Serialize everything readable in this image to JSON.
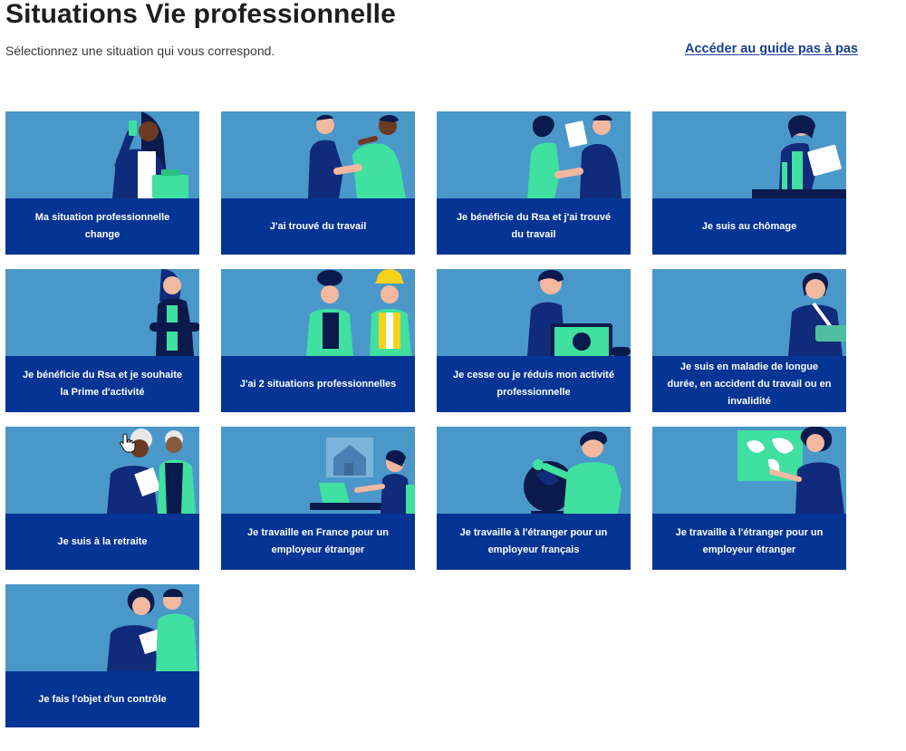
{
  "page": {
    "title": "Situations Vie professionnelle",
    "subtitle": "Sélectionnez une situation qui vous correspond.",
    "guide_link": "Accéder au guide pas à pas"
  },
  "cards": [
    {
      "label": "Ma situation professionnelle change"
    },
    {
      "label": "J'ai trouvé du travail"
    },
    {
      "label": "Je bénéficie du Rsa et j'ai trouvé du travail"
    },
    {
      "label": "Je suis au chômage"
    },
    {
      "label": "Je bénéficie du Rsa et je souhaite la Prime d'activité"
    },
    {
      "label": "J'ai 2 situations professionnelles"
    },
    {
      "label": "Je cesse ou je réduis mon activité professionnelle"
    },
    {
      "label": "Je suis en maladie de longue durée, en accident du travail ou en invalidité"
    },
    {
      "label": "Je suis à la retraite"
    },
    {
      "label": "Je travaille en France pour un employeur étranger"
    },
    {
      "label": "Je travaille à l'étranger pour un employeur français"
    },
    {
      "label": "Je travaille à l'étranger pour un employeur étranger"
    },
    {
      "label": "Je fais l'objet d'un contrôle"
    }
  ],
  "colors": {
    "illustration_bg": "#4a98c9",
    "label_bg": "#043494",
    "accent_green": "#3fe0a0",
    "navy": "#0f2b7a",
    "link": "#1b3f91"
  }
}
